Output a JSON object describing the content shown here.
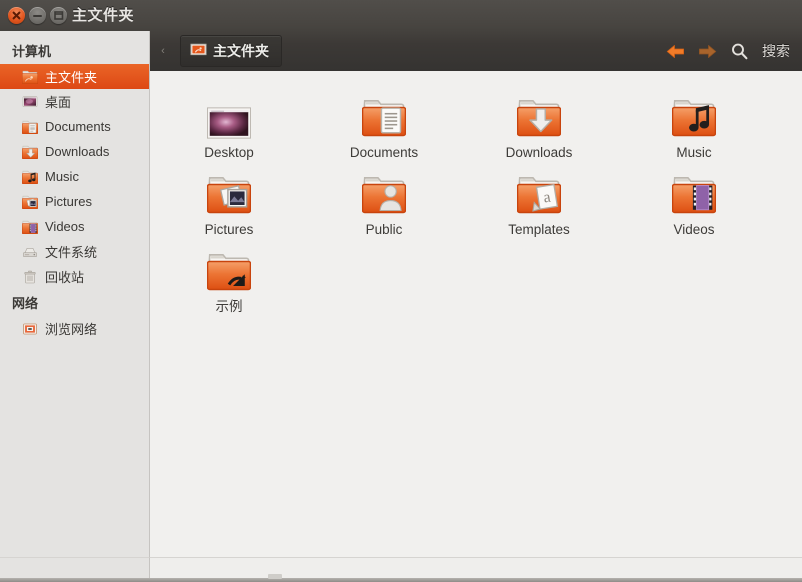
{
  "window": {
    "title": "主文件夹",
    "buttons": [
      {
        "name": "close",
        "icon": "close-icon"
      },
      {
        "name": "minimize",
        "icon": "minimize-icon"
      },
      {
        "name": "maximize",
        "icon": "maximize-icon"
      }
    ]
  },
  "toolbar": {
    "caret": "‹",
    "breadcrumb": {
      "label": "主文件夹",
      "icon": "home-folder-icon"
    },
    "back": {
      "icon": "arrow-left-icon",
      "color": "#f07b28"
    },
    "forward": {
      "icon": "arrow-right-icon",
      "color": "#a8642c"
    },
    "search": {
      "icon": "search-icon",
      "label": "搜索"
    }
  },
  "sidebar": {
    "sections": [
      {
        "heading": "计算机",
        "items": [
          {
            "label": "主文件夹",
            "icon": "home-folder-icon",
            "selected": true
          },
          {
            "label": "桌面",
            "icon": "desktop-icon",
            "selected": false
          },
          {
            "label": "Documents",
            "icon": "documents-folder-icon",
            "selected": false
          },
          {
            "label": "Downloads",
            "icon": "downloads-folder-icon",
            "selected": false
          },
          {
            "label": "Music",
            "icon": "music-folder-icon",
            "selected": false
          },
          {
            "label": "Pictures",
            "icon": "pictures-folder-icon",
            "selected": false
          },
          {
            "label": "Videos",
            "icon": "videos-folder-icon",
            "selected": false
          },
          {
            "label": "文件系统",
            "icon": "filesystem-icon",
            "selected": false
          },
          {
            "label": "回收站",
            "icon": "trash-icon",
            "selected": false
          }
        ]
      },
      {
        "heading": "网络",
        "items": [
          {
            "label": "浏览网络",
            "icon": "network-browse-icon",
            "selected": false
          }
        ]
      }
    ]
  },
  "files": [
    {
      "label": "Desktop",
      "icon": "desktop-wallpaper-icon"
    },
    {
      "label": "Documents",
      "icon": "documents-folder-icon"
    },
    {
      "label": "Downloads",
      "icon": "downloads-folder-icon"
    },
    {
      "label": "Music",
      "icon": "music-folder-icon"
    },
    {
      "label": "Pictures",
      "icon": "pictures-folder-icon"
    },
    {
      "label": "Public",
      "icon": "public-folder-icon"
    },
    {
      "label": "Templates",
      "icon": "templates-folder-icon"
    },
    {
      "label": "Videos",
      "icon": "videos-folder-icon"
    },
    {
      "label": "示例",
      "icon": "link-folder-icon"
    }
  ],
  "colors": {
    "accent": "#dd4814",
    "chrome_dark": "#474440",
    "sidebar_bg": "#e4e3e1",
    "content_bg": "#f1f0ee"
  }
}
